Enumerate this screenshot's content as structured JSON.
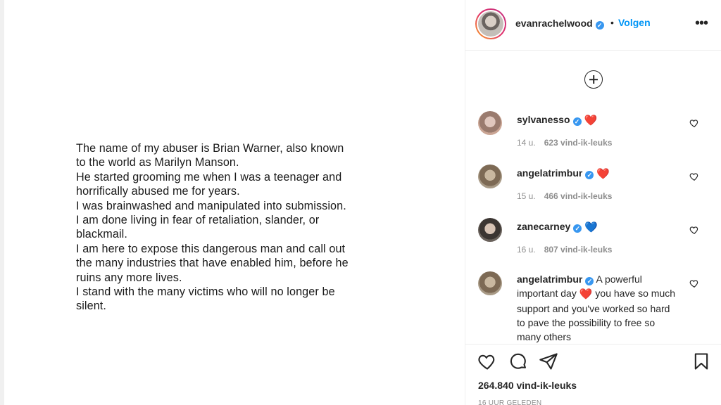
{
  "post": {
    "statement_lines": [
      "The name of my abuser is Brian Warner, also known",
      "to the world as Marilyn Manson.",
      "He started grooming me when I was a teenager and",
      "horrifically abused me for years.",
      "I was brainwashed and manipulated into submission.",
      "I am done living in fear of retaliation, slander, or",
      "blackmail.",
      "I am here to expose this dangerous man and call out",
      "the many industries that have enabled him, before he",
      "ruins any more lives.",
      "I stand with the many victims who will no longer be",
      "silent."
    ]
  },
  "header": {
    "username": "evanrachelwood",
    "separator": "•",
    "follow_label": "Volgen",
    "more_label": "•••"
  },
  "comments": [
    {
      "username": "sylvanesso",
      "text": "",
      "emoji": "❤️",
      "time": "14 u.",
      "likes": "623 vind-ik-leuks"
    },
    {
      "username": "angelatrimbur",
      "text": "",
      "emoji": "❤️",
      "time": "15 u.",
      "likes": "466 vind-ik-leuks"
    },
    {
      "username": "zanecarney",
      "text": "",
      "emoji": "💙",
      "time": "16 u.",
      "likes": "807 vind-ik-leuks"
    },
    {
      "username": "angelatrimbur",
      "text_before": "A powerful important day",
      "emoji": "❤️",
      "text_after": "you have so much support and you've worked so hard to pave the possibility to free so many others"
    }
  ],
  "footer": {
    "likes": "264.840 vind-ik-leuks",
    "timestamp": "16 UUR GELEDEN"
  },
  "colors": {
    "accent": "#0095f6",
    "verified": "#3897f0",
    "heart_red": "#ed4956",
    "heart_blue": "#3ea8f5"
  }
}
